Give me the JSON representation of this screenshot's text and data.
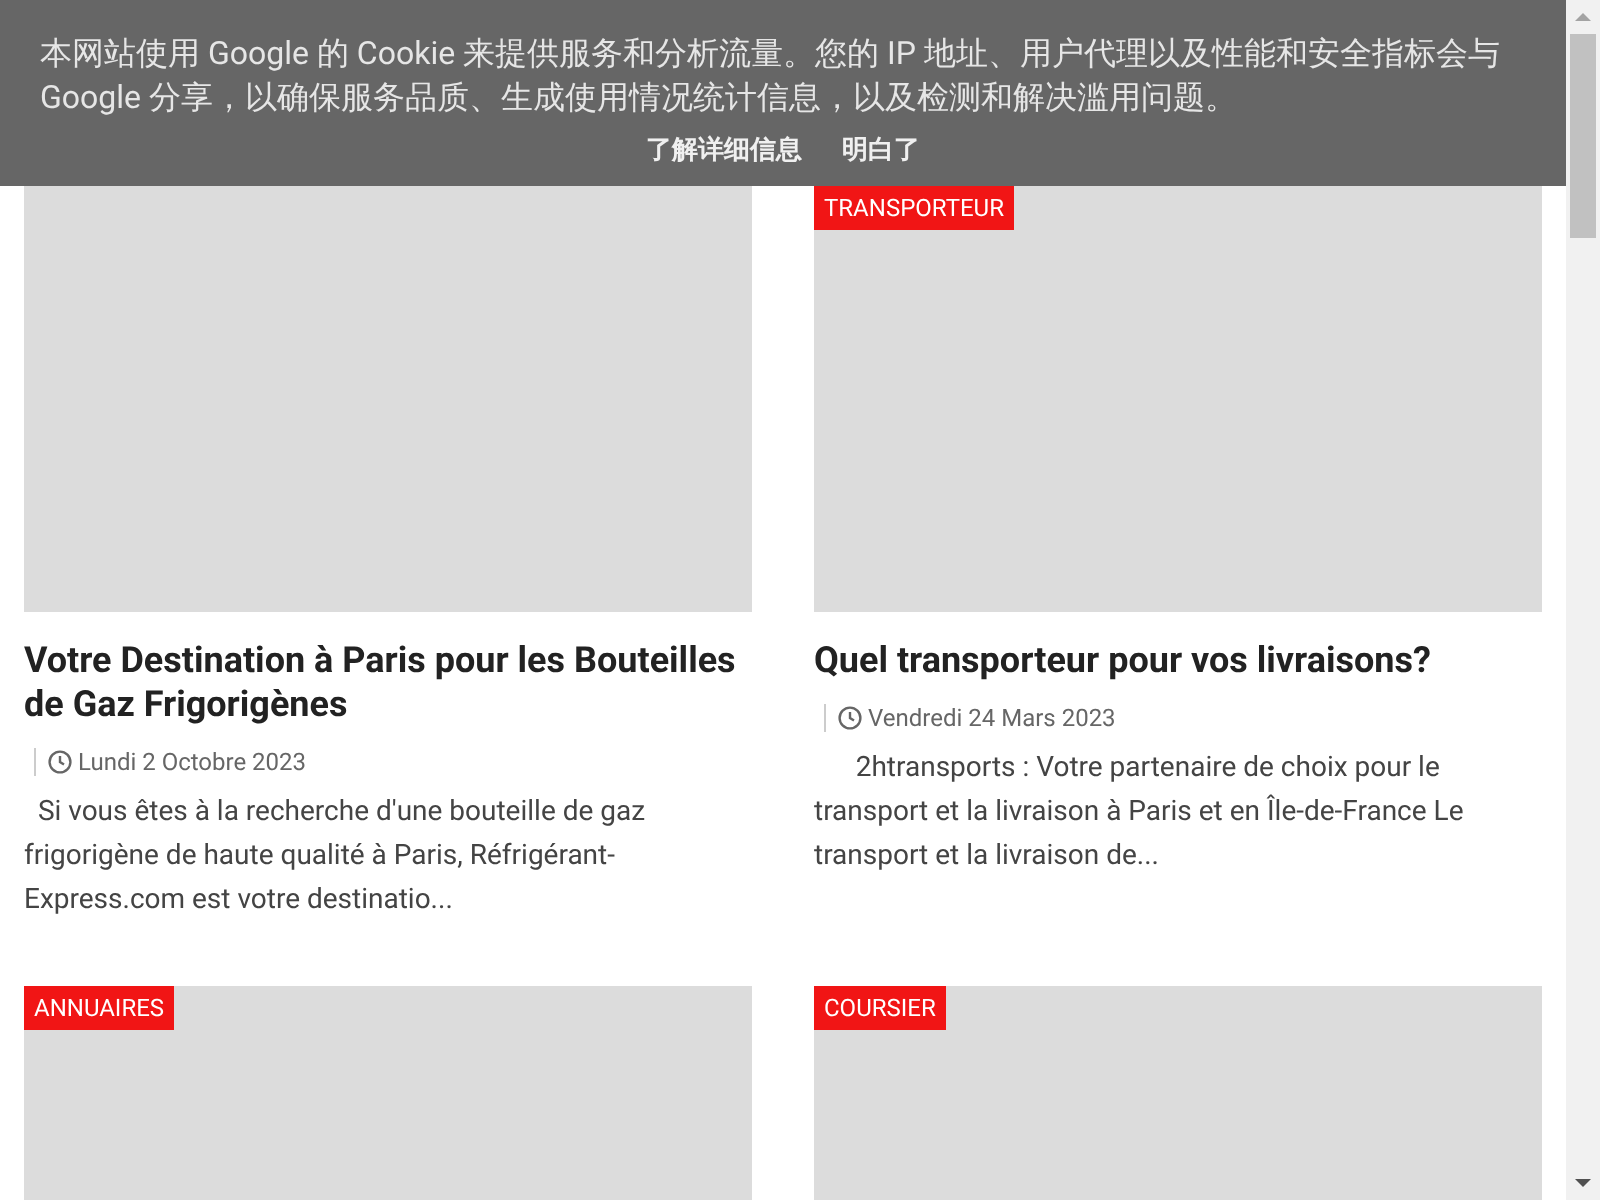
{
  "cookie_banner": {
    "message": "本网站使用 Google 的 Cookie 来提供服务和分析流量。您的 IP 地址、用户代理以及性能和安全指标会与 Google 分享，以确保服务品质、生成使用情况统计信息，以及检测和解决滥用问题。",
    "buttons": [
      "了解详细信息",
      "明白了"
    ]
  },
  "columns": [
    {
      "posts": [
        {
          "title": "Votre Destination à Paris pour les Bouteilles de Gaz Frigorigènes",
          "date": "Lundi 2 Octobre 2023",
          "excerpt": "  Si vous êtes à la recherche d'une bouteille de gaz frigorigène de haute qualité à Paris, Réfrigérant-Express.com est votre destinatio..."
        },
        {
          "category": "ANNUAIRES"
        }
      ]
    },
    {
      "posts": [
        {
          "category": "TRANSPORTEUR",
          "title": "Quel transporteur pour vos livraisons?",
          "date": "Vendredi 24 Mars 2023",
          "excerpt": "      2htransports : Votre partenaire de choix pour le transport et la livraison à Paris et en Île-de-France Le transport et la livraison de..."
        },
        {
          "category": "COURSIER"
        }
      ]
    }
  ]
}
